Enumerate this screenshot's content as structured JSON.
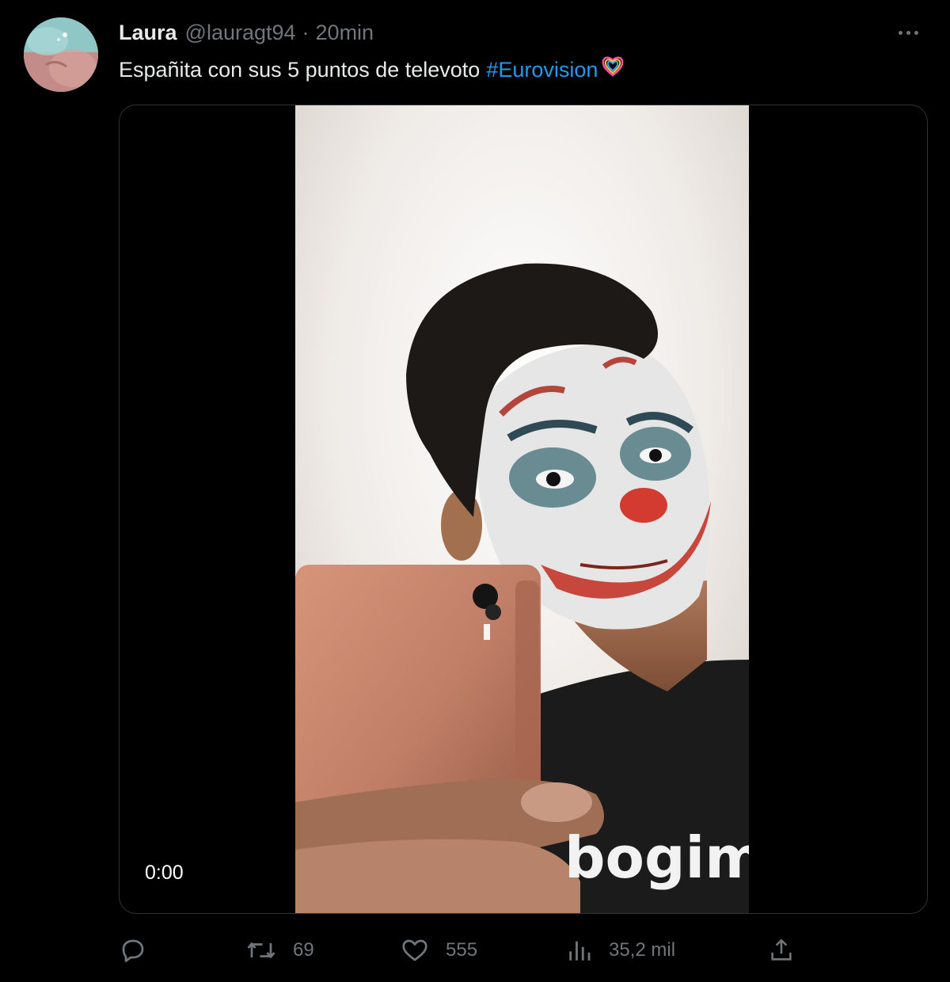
{
  "tweet": {
    "display_name": "Laura",
    "handle": "@lauragt94",
    "separator": "·",
    "time": "20min",
    "text": "Españita con sus 5 puntos de televoto",
    "hashtag": "#Eurovision",
    "more_icon": "more-horizontal-icon"
  },
  "media": {
    "timestamp": "0:00",
    "shirt_text": "bogim"
  },
  "actions": {
    "reply_icon": "reply-icon",
    "retweet_icon": "retweet-icon",
    "retweet_count": "69",
    "like_icon": "heart-icon",
    "like_count": "555",
    "views_icon": "views-icon",
    "views_count": "35,2 mil",
    "share_icon": "share-icon"
  },
  "colors": {
    "background": "#000000",
    "text": "#e7e9ea",
    "muted": "#71767b",
    "link": "#1d9bf0",
    "border": "#2f3336"
  }
}
